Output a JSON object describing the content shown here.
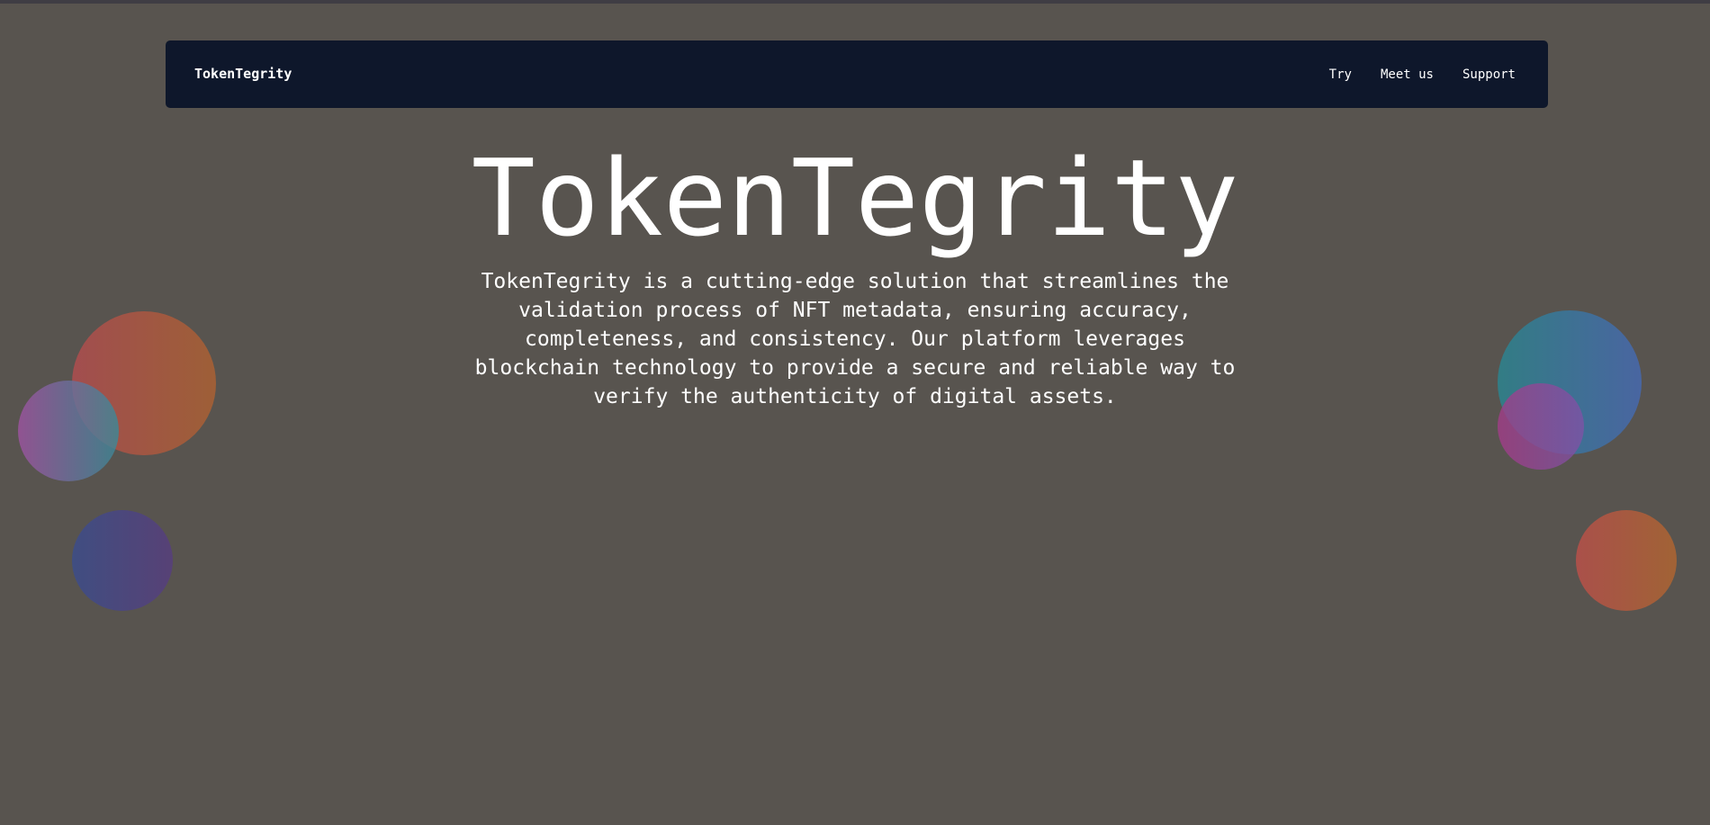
{
  "navbar": {
    "brand": "TokenTegrity",
    "links": [
      {
        "label": "Try"
      },
      {
        "label": "Meet us"
      },
      {
        "label": "Support"
      }
    ],
    "background": "#0e172b"
  },
  "hero": {
    "title": "TokenTegrity",
    "description": "TokenTegrity is a cutting-edge solution that streamlines the validation process of NFT metadata, ensuring accuracy, completeness, and consistency. Our platform leverages blockchain technology to provide a secure and reliable way to verify the authenticity of digital assets."
  },
  "theme": {
    "page_background": "#58544f",
    "text_color": "#ffffff"
  }
}
